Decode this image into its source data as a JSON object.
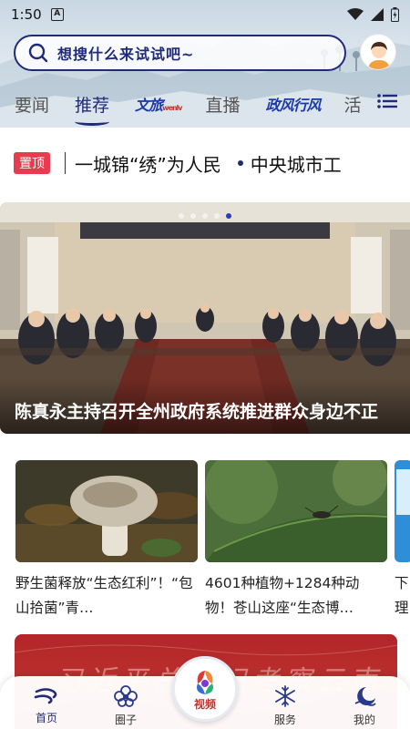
{
  "status_bar": {
    "time": "1:50",
    "notification_letter": "A"
  },
  "search": {
    "placeholder": "想搜什么来试试吧~"
  },
  "tabs": [
    {
      "label": "要闻",
      "active": false
    },
    {
      "label": "推荐",
      "active": true
    },
    {
      "label": "文旅",
      "logo": true,
      "sub": "wenlv"
    },
    {
      "label": "直播",
      "active": false
    },
    {
      "label": "政风行风",
      "logo": true
    },
    {
      "label": "活",
      "active": false
    }
  ],
  "ticker": {
    "badge": "置顶",
    "items": [
      "一城锦“绣”为人民",
      "中央城市工"
    ]
  },
  "banner": {
    "caption": "陈真永主持召开全州政府系统推进群众身边不正",
    "dot_count": 5,
    "active_dot": 4
  },
  "cards": [
    {
      "title": "野生菌释放“生态红利”！“包山拾菌”青…",
      "image": "mushroom-photo"
    },
    {
      "title": "4601种植物+1284种动物！苍山这座“生态博…",
      "image": "insect-leaf-photo"
    },
    {
      "title": "下理",
      "image": "partial-card-photo"
    }
  ],
  "red_card": {
    "text": "习近平总书记考察云南"
  },
  "bottom_nav": {
    "items": [
      {
        "label": "首页",
        "icon": "home-wind-icon",
        "active": true
      },
      {
        "label": "圈子",
        "icon": "circle-flower-icon",
        "active": false
      },
      {
        "label": "视频",
        "icon": "video-petal-icon",
        "active": false,
        "center": true
      },
      {
        "label": "服务",
        "icon": "service-snowflake-icon",
        "active": false
      },
      {
        "label": "我的",
        "icon": "moon-profile-icon",
        "active": false
      }
    ]
  },
  "colors": {
    "brand_navy": "#1f2a7a",
    "badge_red": "#e83b4e",
    "red_card": "#b2262a"
  }
}
